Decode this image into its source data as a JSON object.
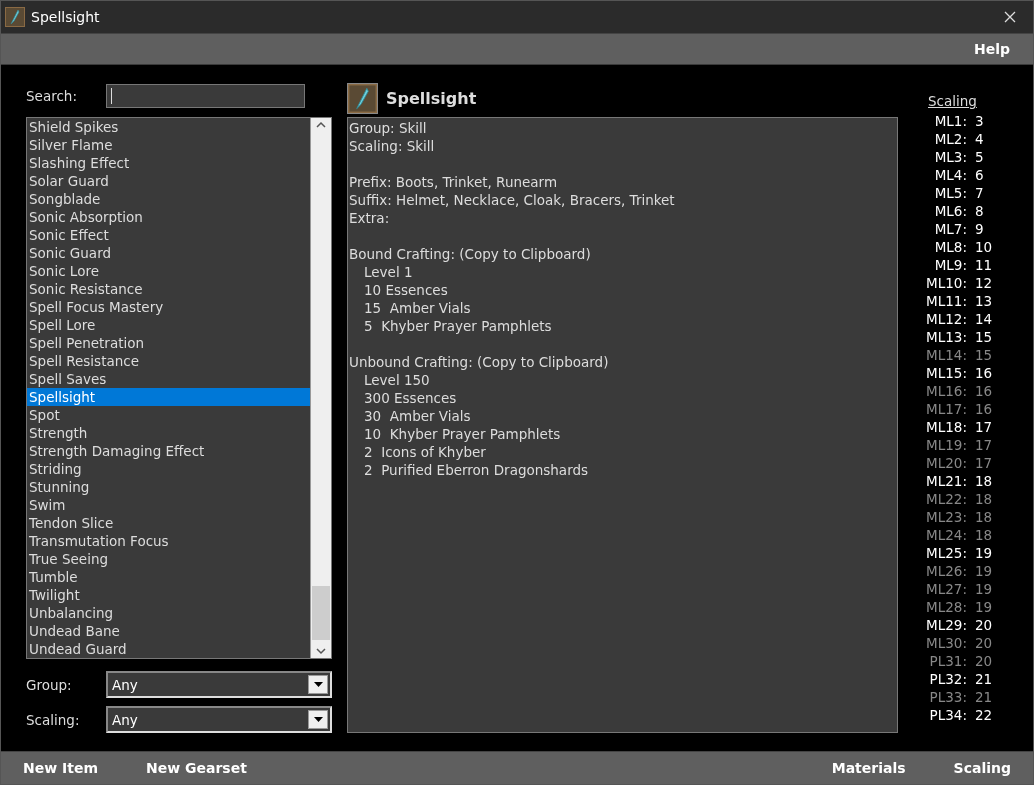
{
  "window": {
    "title": "Spellsight"
  },
  "menu": [
    "Help"
  ],
  "search": {
    "label": "Search:"
  },
  "list": [
    {
      "label": "Shield Spikes",
      "selected": false
    },
    {
      "label": "Silver Flame",
      "selected": false
    },
    {
      "label": "Slashing Effect",
      "selected": false
    },
    {
      "label": "Solar Guard",
      "selected": false
    },
    {
      "label": "Songblade",
      "selected": false
    },
    {
      "label": "Sonic Absorption",
      "selected": false
    },
    {
      "label": "Sonic Effect",
      "selected": false
    },
    {
      "label": "Sonic Guard",
      "selected": false
    },
    {
      "label": "Sonic Lore",
      "selected": false
    },
    {
      "label": "Sonic Resistance",
      "selected": false
    },
    {
      "label": "Spell Focus Mastery",
      "selected": false
    },
    {
      "label": "Spell Lore",
      "selected": false
    },
    {
      "label": "Spell Penetration",
      "selected": false
    },
    {
      "label": "Spell Resistance",
      "selected": false
    },
    {
      "label": "Spell Saves",
      "selected": false
    },
    {
      "label": "Spellsight",
      "selected": true
    },
    {
      "label": "Spot",
      "selected": false
    },
    {
      "label": "Strength",
      "selected": false
    },
    {
      "label": "Strength Damaging Effect",
      "selected": false
    },
    {
      "label": "Striding",
      "selected": false
    },
    {
      "label": "Stunning",
      "selected": false
    },
    {
      "label": "Swim",
      "selected": false
    },
    {
      "label": "Tendon Slice",
      "selected": false
    },
    {
      "label": "Transmutation Focus",
      "selected": false
    },
    {
      "label": "True Seeing",
      "selected": false
    },
    {
      "label": "Tumble",
      "selected": false
    },
    {
      "label": "Twilight",
      "selected": false
    },
    {
      "label": "Unbalancing",
      "selected": false
    },
    {
      "label": "Undead Bane",
      "selected": false
    },
    {
      "label": "Undead Guard",
      "selected": false
    }
  ],
  "filters": [
    {
      "label": "Group:",
      "value": "Any"
    },
    {
      "label": "Scaling:",
      "value": "Any"
    }
  ],
  "detail": {
    "title": "Spellsight",
    "lines": [
      {
        "kind": "text",
        "text": "Group: Skill"
      },
      {
        "kind": "text",
        "text": "Scaling: Skill"
      },
      {
        "kind": "gap"
      },
      {
        "kind": "text",
        "text": "Prefix: Boots, Trinket, Runearm"
      },
      {
        "kind": "text",
        "text": "Suffix: Helmet, Necklace, Cloak, Bracers, Trinket"
      },
      {
        "kind": "text",
        "text": "Extra:"
      },
      {
        "kind": "gap"
      },
      {
        "kind": "heading",
        "text": "Bound Crafting:",
        "link": "(Copy to Clipboard)"
      },
      {
        "kind": "indent",
        "text": "Level 1"
      },
      {
        "kind": "indent",
        "text": "10 Essences"
      },
      {
        "kind": "indent",
        "text": "15  Amber Vials"
      },
      {
        "kind": "indent",
        "text": "5  Khyber Prayer Pamphlets"
      },
      {
        "kind": "gap"
      },
      {
        "kind": "heading",
        "text": "Unbound Crafting:",
        "link": "(Copy to Clipboard)"
      },
      {
        "kind": "indent",
        "text": "Level 150"
      },
      {
        "kind": "indent",
        "text": "300 Essences"
      },
      {
        "kind": "indent",
        "text": "30  Amber Vials"
      },
      {
        "kind": "indent",
        "text": "10  Khyber Prayer Pamphlets"
      },
      {
        "kind": "indent",
        "text": "2  Icons of Khyber"
      },
      {
        "kind": "indent",
        "text": "2  Purified Eberron Dragonshards"
      }
    ]
  },
  "scaling": {
    "title": "Scaling",
    "rows": [
      {
        "level": "ML1:",
        "value": "3",
        "active": true
      },
      {
        "level": "ML2:",
        "value": "4",
        "active": true
      },
      {
        "level": "ML3:",
        "value": "5",
        "active": true
      },
      {
        "level": "ML4:",
        "value": "6",
        "active": true
      },
      {
        "level": "ML5:",
        "value": "7",
        "active": true
      },
      {
        "level": "ML6:",
        "value": "8",
        "active": true
      },
      {
        "level": "ML7:",
        "value": "9",
        "active": true
      },
      {
        "level": "ML8:",
        "value": "10",
        "active": true
      },
      {
        "level": "ML9:",
        "value": "11",
        "active": true
      },
      {
        "level": "ML10:",
        "value": "12",
        "active": true
      },
      {
        "level": "ML11:",
        "value": "13",
        "active": true
      },
      {
        "level": "ML12:",
        "value": "14",
        "active": true
      },
      {
        "level": "ML13:",
        "value": "15",
        "active": true
      },
      {
        "level": "ML14:",
        "value": "15",
        "active": false
      },
      {
        "level": "ML15:",
        "value": "16",
        "active": true
      },
      {
        "level": "ML16:",
        "value": "16",
        "active": false
      },
      {
        "level": "ML17:",
        "value": "16",
        "active": false
      },
      {
        "level": "ML18:",
        "value": "17",
        "active": true
      },
      {
        "level": "ML19:",
        "value": "17",
        "active": false
      },
      {
        "level": "ML20:",
        "value": "17",
        "active": false
      },
      {
        "level": "ML21:",
        "value": "18",
        "active": true
      },
      {
        "level": "ML22:",
        "value": "18",
        "active": false
      },
      {
        "level": "ML23:",
        "value": "18",
        "active": false
      },
      {
        "level": "ML24:",
        "value": "18",
        "active": false
      },
      {
        "level": "ML25:",
        "value": "19",
        "active": true
      },
      {
        "level": "ML26:",
        "value": "19",
        "active": false
      },
      {
        "level": "ML27:",
        "value": "19",
        "active": false
      },
      {
        "level": "ML28:",
        "value": "19",
        "active": false
      },
      {
        "level": "ML29:",
        "value": "20",
        "active": true
      },
      {
        "level": "ML30:",
        "value": "20",
        "active": false
      },
      {
        "level": "PL31:",
        "value": "20",
        "active": false
      },
      {
        "level": "PL32:",
        "value": "21",
        "active": true
      },
      {
        "level": "PL33:",
        "value": "21",
        "active": false
      },
      {
        "level": "PL34:",
        "value": "22",
        "active": true
      }
    ]
  },
  "bottom_bar": {
    "left": [
      "New Item",
      "New Gearset"
    ],
    "right": [
      "Materials",
      "Scaling"
    ]
  }
}
